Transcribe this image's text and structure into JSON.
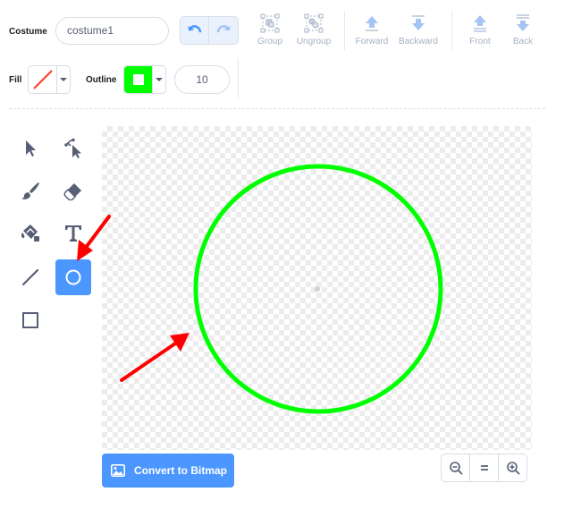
{
  "toolbar": {
    "costume_label": "Costume",
    "costume_name": "costume1",
    "group_label": "Group",
    "ungroup_label": "Ungroup",
    "forward_label": "Forward",
    "backward_label": "Backward",
    "front_label": "Front",
    "back_label": "Back"
  },
  "style_bar": {
    "fill_label": "Fill",
    "outline_label": "Outline",
    "outline_size": "10",
    "fill_color": "none",
    "outline_color": "#00ff00"
  },
  "tools": [
    {
      "name": "select-icon"
    },
    {
      "name": "reshape-icon"
    },
    {
      "name": "brush-icon"
    },
    {
      "name": "eraser-icon"
    },
    {
      "name": "fill-bucket-icon"
    },
    {
      "name": "text-icon"
    },
    {
      "name": "line-icon"
    },
    {
      "name": "circle-icon",
      "active": true
    },
    {
      "name": "rectangle-icon"
    }
  ],
  "footer": {
    "convert_label": "Convert to Bitmap"
  },
  "colors": {
    "accent": "#4c97ff",
    "circle_stroke": "#00ff00",
    "annotation_arrow": "#ff0000"
  }
}
